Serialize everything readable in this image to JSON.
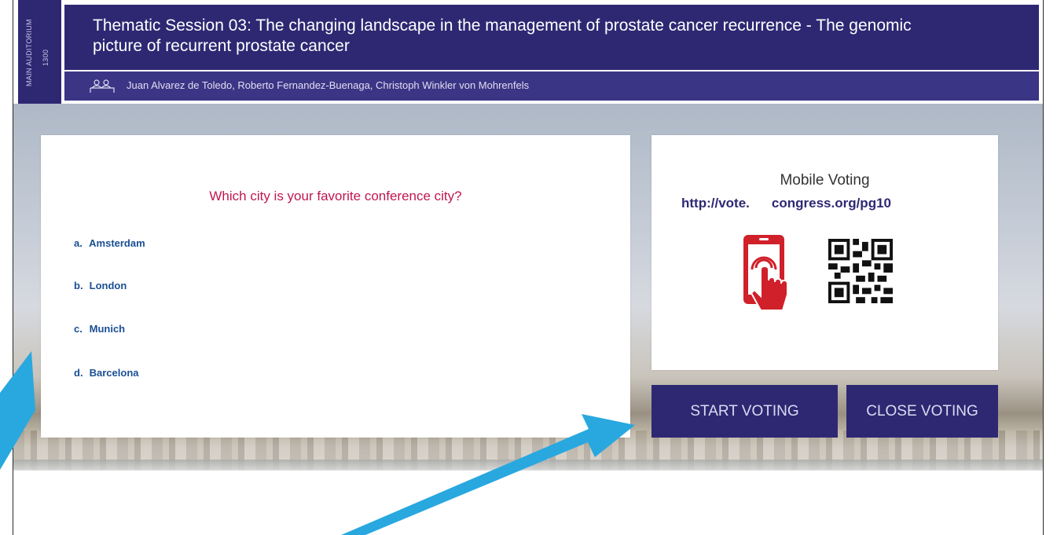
{
  "header": {
    "room_label": "MAIN AUDITORIUM",
    "time_label": "1300",
    "title": "Thematic Session 03: The changing landscape in the management of prostate cancer recurrence - The genomic picture of recurrent prostate cancer",
    "presenters": "Juan Alvarez de Toledo, Roberto Fernandez-Buenaga, Christoph Winkler von Mohrenfels",
    "presenter_icon": "people-icon"
  },
  "poll": {
    "question": "Which city is your favorite conference city?",
    "options": [
      {
        "letter": "a.",
        "text": "Amsterdam"
      },
      {
        "letter": "b.",
        "text": "London"
      },
      {
        "letter": "c.",
        "text": "Munich"
      },
      {
        "letter": "d.",
        "text": "Barcelona"
      }
    ]
  },
  "voting": {
    "title": "Mobile Voting",
    "url_part1": "http://vote.",
    "url_part2": "congress.org/pg10",
    "phone_icon": "phone-tap-icon",
    "qr_icon": "qr-code-icon",
    "start_label": "START VOTING",
    "close_label": "CLOSE VOTING"
  },
  "colors": {
    "header_bg": "#2e2873",
    "question": "#c0174f",
    "options": "#1a4f93",
    "arrow": "#29a8df",
    "phone": "#d0202a"
  }
}
